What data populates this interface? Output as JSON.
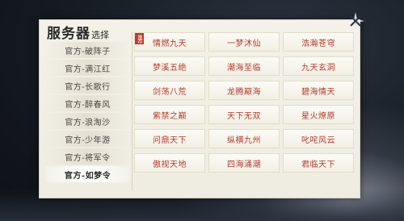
{
  "title": {
    "main": "服务器",
    "sub": "选择"
  },
  "close_icon": "close-star-icon",
  "servers_tag": "推荐",
  "sidebar": {
    "active_index": 7,
    "items": [
      {
        "label": "官方-破阵子"
      },
      {
        "label": "官方-满江红"
      },
      {
        "label": "官方-长歌行"
      },
      {
        "label": "官方-醉春风"
      },
      {
        "label": "官方-浪淘沙"
      },
      {
        "label": "官方-少年游"
      },
      {
        "label": "官方-将军令"
      },
      {
        "label": "官方-如梦令"
      }
    ]
  },
  "servers": [
    {
      "label": "情燃九天"
    },
    {
      "label": "一梦沐仙"
    },
    {
      "label": "浩瀚苍穹"
    },
    {
      "label": "梦溪五绝"
    },
    {
      "label": "潮海至临"
    },
    {
      "label": "九天玄洞"
    },
    {
      "label": "剑荡八荒"
    },
    {
      "label": "龙腾巅海"
    },
    {
      "label": "碧海情天"
    },
    {
      "label": "紫禁之巅"
    },
    {
      "label": "天下无双"
    },
    {
      "label": "星火燎原"
    },
    {
      "label": "问鼎天下"
    },
    {
      "label": "纵横九州"
    },
    {
      "label": "叱咤风云"
    },
    {
      "label": "傲视天地"
    },
    {
      "label": "四海涌潮"
    },
    {
      "label": "君临天下"
    }
  ]
}
